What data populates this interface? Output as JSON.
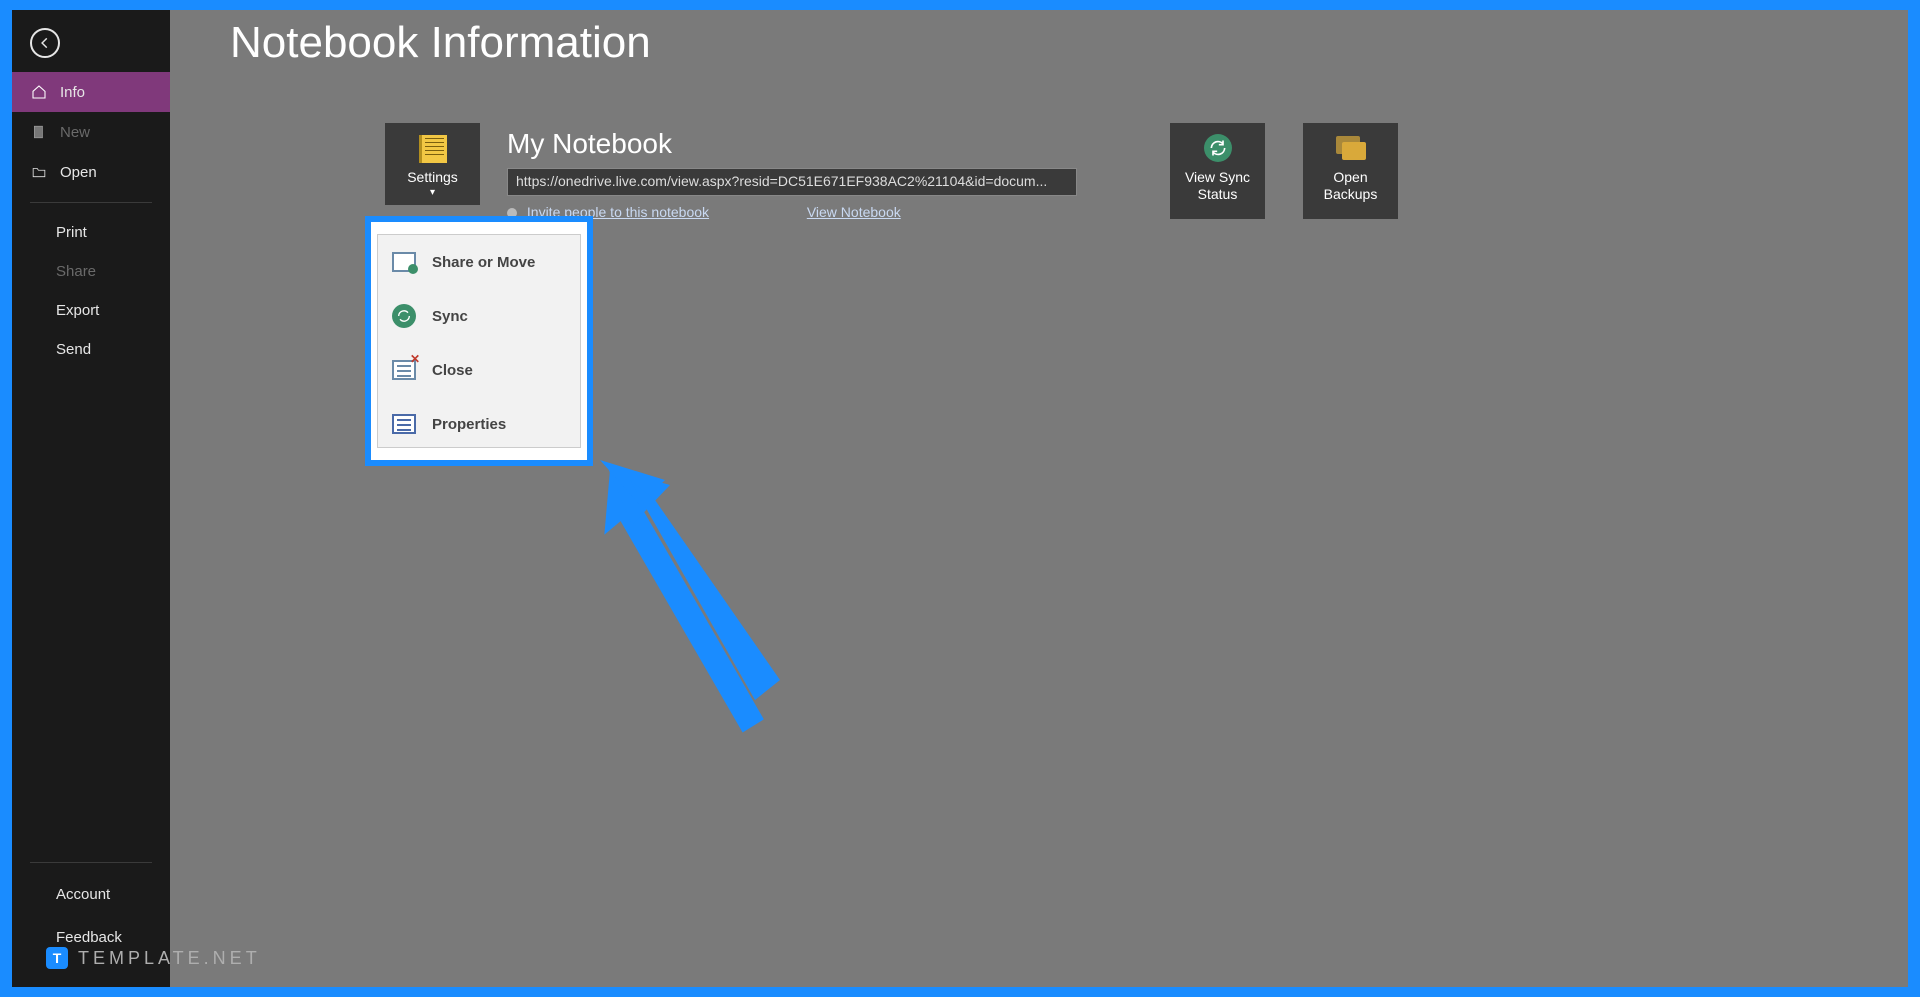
{
  "page_title": "Notebook Information",
  "sidebar": {
    "items": [
      {
        "label": "Info",
        "icon": "home"
      },
      {
        "label": "New",
        "icon": "doc",
        "disabled": true
      },
      {
        "label": "Open",
        "icon": "folder"
      }
    ],
    "sub_items": [
      {
        "label": "Print"
      },
      {
        "label": "Share",
        "disabled": true
      },
      {
        "label": "Export"
      },
      {
        "label": "Send"
      }
    ],
    "bottom": [
      {
        "label": "Account"
      },
      {
        "label": "Feedback"
      }
    ]
  },
  "notebook": {
    "name": "My Notebook",
    "settings_label": "Settings",
    "url": "https://onedrive.live.com/view.aspx?resid=DC51E671EF938AC2%21104&id=docum...",
    "invite_link": "Invite people to this notebook",
    "view_link": "View Notebook"
  },
  "tiles": {
    "view_sync_l1": "View Sync",
    "view_sync_l2": "Status",
    "open_backups_l1": "Open",
    "open_backups_l2": "Backups"
  },
  "dropdown": {
    "share": "Share or Move",
    "sync": "Sync",
    "close": "Close",
    "properties": "Properties"
  },
  "watermark": {
    "badge": "T",
    "text": "TEMPLATE.NET"
  }
}
